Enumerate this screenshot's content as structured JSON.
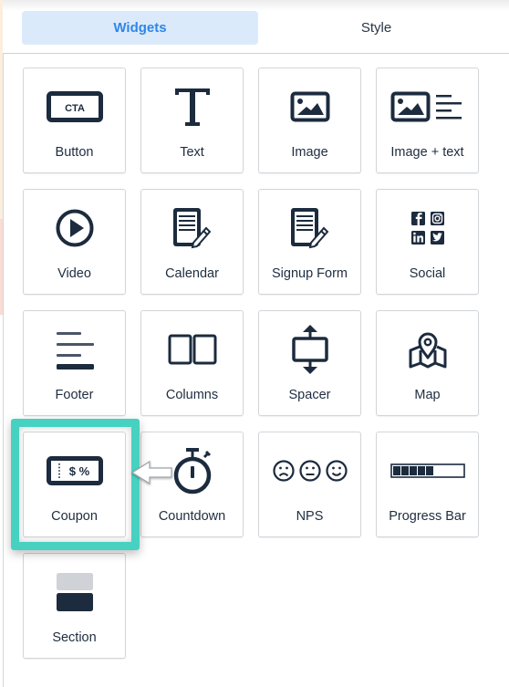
{
  "tabs": [
    {
      "label": "Widgets",
      "active": true
    },
    {
      "label": "Style",
      "active": false
    }
  ],
  "colors": {
    "active_tab_bg": "#dbeafb",
    "active_tab_text": "#2f86e8",
    "icon": "#1c2b3e",
    "highlight": "#47d1c1"
  },
  "widgets": [
    {
      "label": "Button",
      "icon": "cta-button-icon",
      "icon_text": "CTA"
    },
    {
      "label": "Text",
      "icon": "text-t-icon",
      "icon_text": "T"
    },
    {
      "label": "Image",
      "icon": "image-icon"
    },
    {
      "label": "Image + text",
      "icon": "image-text-icon"
    },
    {
      "label": "Video",
      "icon": "play-circle-icon"
    },
    {
      "label": "Calendar",
      "icon": "document-pencil-icon"
    },
    {
      "label": "Signup Form",
      "icon": "document-pencil-icon"
    },
    {
      "label": "Social",
      "icon": "social-icons"
    },
    {
      "label": "Footer",
      "icon": "footer-lines-icon"
    },
    {
      "label": "Columns",
      "icon": "columns-icon"
    },
    {
      "label": "Spacer",
      "icon": "spacer-arrows-icon"
    },
    {
      "label": "Map",
      "icon": "map-pin-icon"
    },
    {
      "label": "Coupon",
      "icon": "coupon-icon",
      "icon_text": "$ %",
      "highlighted": true
    },
    {
      "label": "Countdown",
      "icon": "stopwatch-icon"
    },
    {
      "label": "NPS",
      "icon": "faces-icon"
    },
    {
      "label": "Progress Bar",
      "icon": "progress-bar-icon",
      "progress_filled_segments": 5
    },
    {
      "label": "Section",
      "icon": "section-blocks-icon"
    }
  ]
}
